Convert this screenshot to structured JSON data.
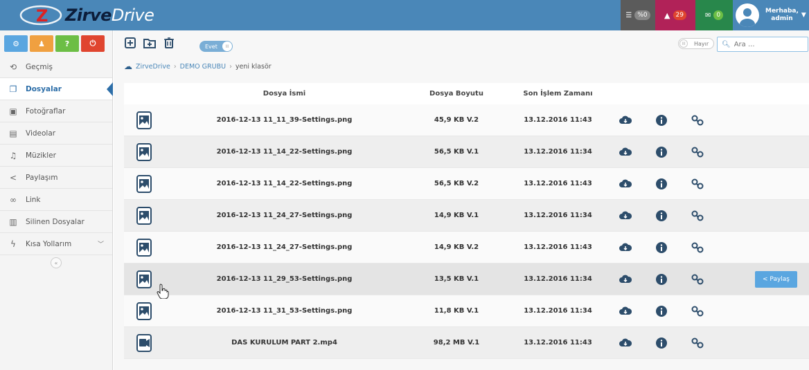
{
  "header": {
    "logo_bold": "Zirve",
    "logo_light": "Drive",
    "storage_badge": "%0",
    "notifications_count": "29",
    "messages_count": "0",
    "greeting": "Merhaba,",
    "username": "admin",
    "colors": {
      "header_bg": "#4a87b8",
      "gray": "#5b5b5b",
      "red": "#b12258",
      "green": "#28874b"
    }
  },
  "sidebar": {
    "top_buttons": [
      {
        "icon": "settings-icon",
        "color": "#5aa6e0",
        "label": "⚙"
      },
      {
        "icon": "user-icon",
        "color": "#f0a040",
        "label": "♟"
      },
      {
        "icon": "help-icon",
        "color": "#6cbe45",
        "label": "?"
      },
      {
        "icon": "power-icon",
        "color": "#e0452f",
        "label": "⏻"
      }
    ],
    "items": [
      {
        "label": "Geçmiş",
        "icon": "history-icon",
        "glyph": "⟲"
      },
      {
        "label": "Dosyalar",
        "icon": "files-icon",
        "glyph": "❐",
        "active": true
      },
      {
        "label": "Fotoğraflar",
        "icon": "photos-icon",
        "glyph": "▣"
      },
      {
        "label": "Videolar",
        "icon": "videos-icon",
        "glyph": "▤"
      },
      {
        "label": "Müzikler",
        "icon": "music-icon",
        "glyph": "♫"
      },
      {
        "label": "Paylaşım",
        "icon": "share-icon",
        "glyph": "<"
      },
      {
        "label": "Link",
        "icon": "link-icon",
        "glyph": "∞"
      },
      {
        "label": "Silinen Dosyalar",
        "icon": "trash-icon",
        "glyph": "▥"
      },
      {
        "label": "Kısa Yollarım",
        "icon": "shortcut-icon",
        "glyph": "ϟ",
        "chevron": "﹀"
      }
    ],
    "collapse_label": "«"
  },
  "toolbar": {
    "toggle_evet": "Evet",
    "toggle_hayir": "Hayır",
    "search_placeholder": "Ara ..."
  },
  "breadcrumb": [
    "ZirveDrive",
    "DEMO GRUBU",
    "yeni klasör"
  ],
  "table": {
    "headers": {
      "name": "Dosya İsmi",
      "size": "Dosya Boyutu",
      "date": "Son İşlem Zamanı"
    },
    "rows": [
      {
        "type": "image",
        "name": "2016-12-13 11_11_39-Settings.png",
        "size": "45,9 KB V.2",
        "date": "13.12.2016 11:43"
      },
      {
        "type": "image",
        "name": "2016-12-13 11_14_22-Settings.png",
        "size": "56,5 KB V.1",
        "date": "13.12.2016 11:34"
      },
      {
        "type": "image",
        "name": "2016-12-13 11_14_22-Settings.png",
        "size": "56,5 KB V.2",
        "date": "13.12.2016 11:43"
      },
      {
        "type": "image",
        "name": "2016-12-13 11_24_27-Settings.png",
        "size": "14,9 KB V.1",
        "date": "13.12.2016 11:34"
      },
      {
        "type": "image",
        "name": "2016-12-13 11_24_27-Settings.png",
        "size": "14,9 KB V.2",
        "date": "13.12.2016 11:43"
      },
      {
        "type": "image",
        "name": "2016-12-13 11_29_53-Settings.png",
        "size": "13,5 KB V.1",
        "date": "13.12.2016 11:34",
        "hover": true
      },
      {
        "type": "image",
        "name": "2016-12-13 11_31_53-Settings.png",
        "size": "11,8 KB V.1",
        "date": "13.12.2016 11:34"
      },
      {
        "type": "video",
        "name": "DAS KURULUM PART 2.mp4",
        "size": "98,2 MB V.1",
        "date": "13.12.2016 11:43"
      }
    ],
    "share_label": "Paylaş"
  }
}
